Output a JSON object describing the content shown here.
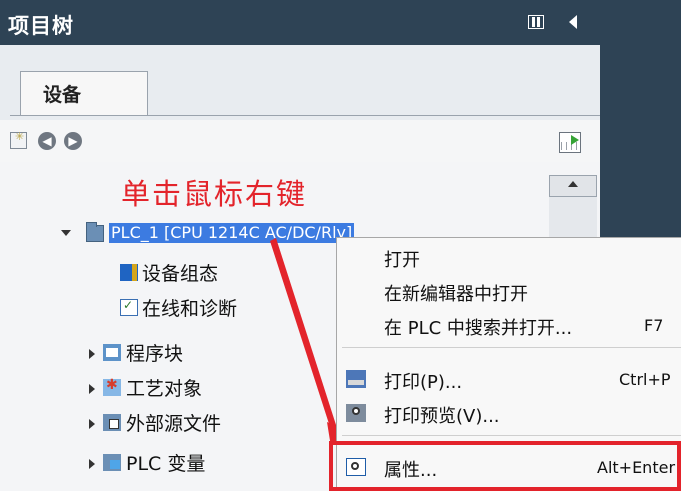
{
  "window": {
    "title": "项目树"
  },
  "tabs": [
    {
      "label": "设备"
    }
  ],
  "annotation": {
    "text": "单击鼠标右键"
  },
  "tree": {
    "root_label": "PLC_1 [CPU 1214C AC/DC/Rly]",
    "items": [
      {
        "label": "设备组态",
        "icon": "device-config-icon"
      },
      {
        "label": "在线和诊断",
        "icon": "online-diagnostics-icon"
      },
      {
        "label": "程序块",
        "icon": "program-blocks-icon"
      },
      {
        "label": "工艺对象",
        "icon": "technology-objects-icon"
      },
      {
        "label": "外部源文件",
        "icon": "external-source-icon"
      },
      {
        "label": "PLC 变量",
        "icon": "plc-variables-icon"
      }
    ]
  },
  "context_menu": {
    "items": [
      {
        "label": "打开",
        "shortcut": ""
      },
      {
        "label": "在新编辑器中打开",
        "shortcut": ""
      },
      {
        "label": "在 PLC 中搜索并打开...",
        "shortcut": "F7"
      },
      {
        "label": "打印(P)...",
        "shortcut": "Ctrl+P"
      },
      {
        "label": "打印预览(V)...",
        "shortcut": ""
      },
      {
        "label": "属性...",
        "shortcut": "Alt+Enter"
      }
    ]
  },
  "colors": {
    "title_bar": "#2e4355",
    "selection": "#3c7be1",
    "annotation": "#e3242b",
    "highlight_box": "#e3232b"
  }
}
